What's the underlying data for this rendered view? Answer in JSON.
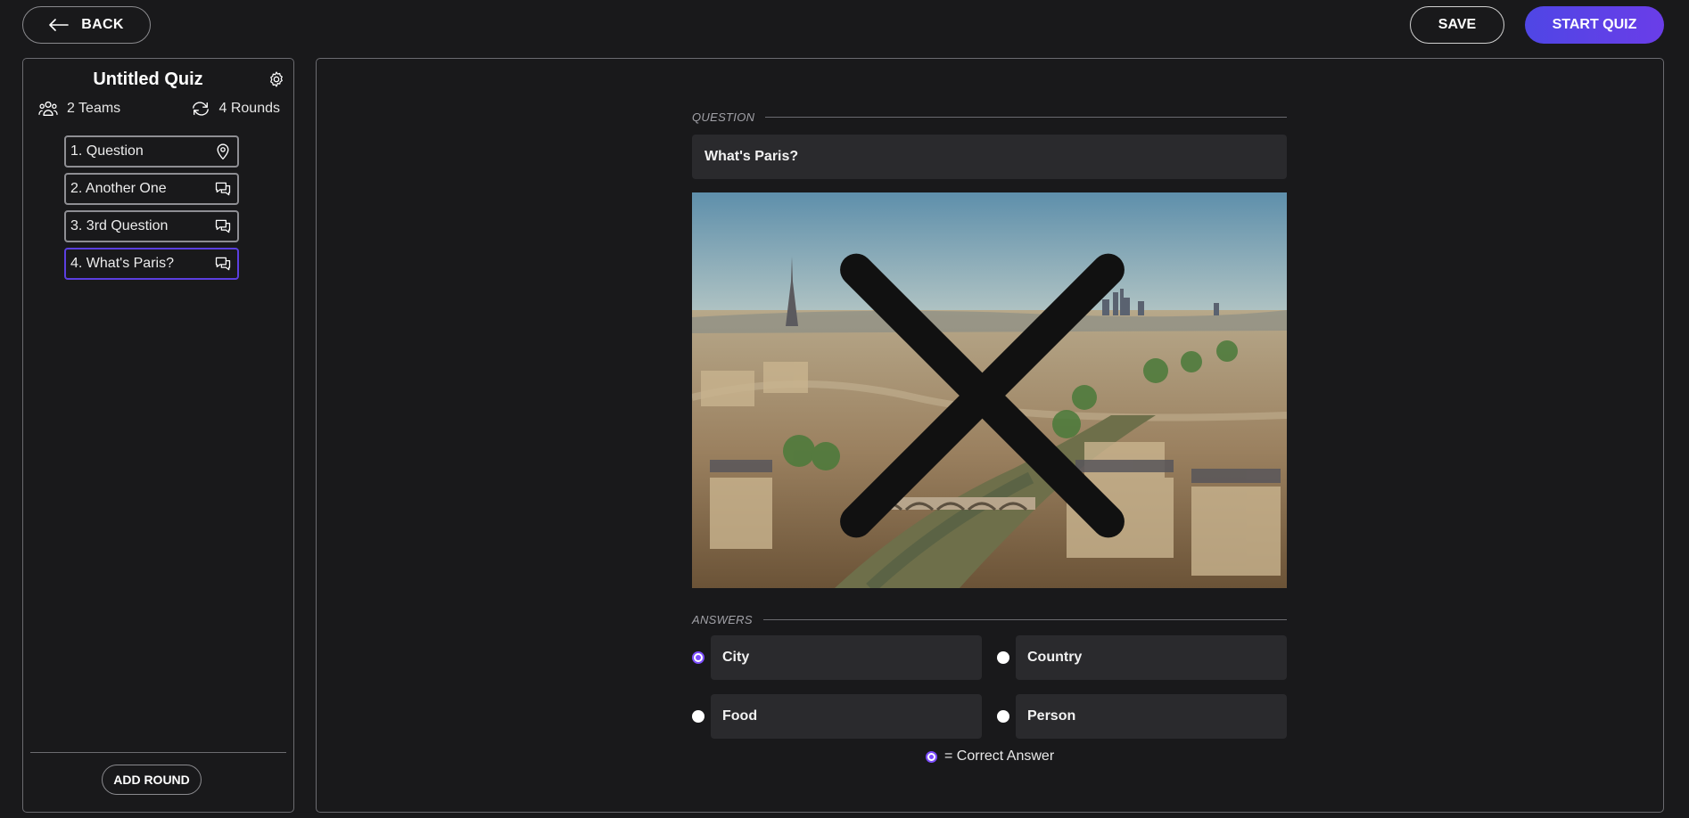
{
  "header": {
    "back_label": "BACK",
    "save_label": "SAVE",
    "start_label": "START QUIZ"
  },
  "sidebar": {
    "title": "Untitled Quiz",
    "teams": "2 Teams",
    "rounds_count": "4 Rounds",
    "rounds": [
      {
        "label": "1. Question",
        "icon": "location-pin-icon"
      },
      {
        "label": "2. Another One",
        "icon": "chat-bubbles-icon"
      },
      {
        "label": "3. 3rd Question",
        "icon": "chat-bubbles-icon"
      },
      {
        "label": "4. What's Paris?",
        "icon": "chat-bubbles-icon",
        "active": true
      }
    ],
    "add_round_label": "ADD ROUND"
  },
  "editor": {
    "question_label": "QUESTION",
    "question_value": "What's Paris?",
    "image": "paris-cityscape",
    "answers_label": "ANSWERS",
    "answers": [
      {
        "value": "City",
        "correct": true
      },
      {
        "value": "Country",
        "correct": false
      },
      {
        "value": "Food",
        "correct": false
      },
      {
        "value": "Person",
        "correct": false
      }
    ],
    "legend_text": "= Correct Answer"
  },
  "colors": {
    "background": "#19191b",
    "accent": "#5b3fe0",
    "field_bg": "#2a2a2d"
  }
}
